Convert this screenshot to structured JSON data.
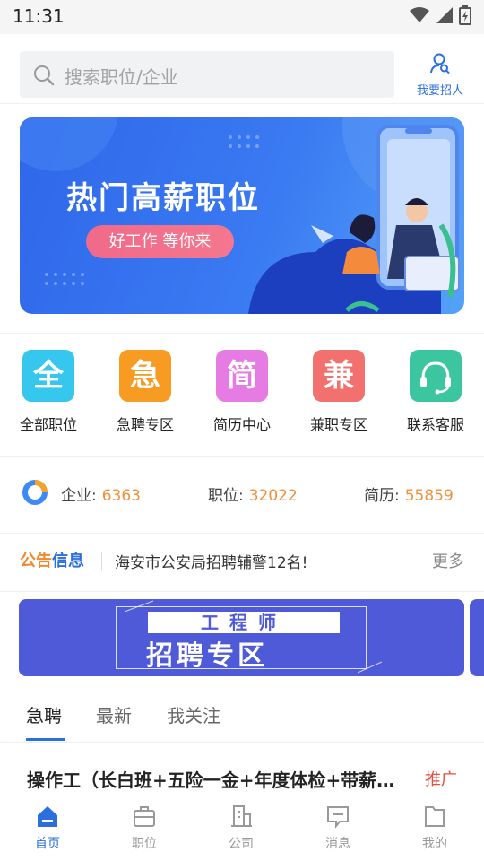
{
  "status_bar": {
    "time": "11:31",
    "icons": [
      "wifi-icon",
      "signal-icon",
      "battery-icon"
    ]
  },
  "search": {
    "placeholder": "搜索职位/企业",
    "recruit_label": "我要招人"
  },
  "banner": {
    "title": "热门高薪职位",
    "pill": "好工作 等你来"
  },
  "categories": [
    {
      "glyph": "全",
      "label": "全部职位",
      "color": "#35c7ee"
    },
    {
      "glyph": "急",
      "label": "急聘专区",
      "color": "#f79b22"
    },
    {
      "glyph": "简",
      "label": "简历中心",
      "color": "#e57be3"
    },
    {
      "glyph": "兼",
      "label": "兼职专区",
      "color": "#f2706d"
    },
    {
      "glyph": "",
      "label": "联系客服",
      "color": "#3cc6a0",
      "icon": "headset-icon"
    }
  ],
  "stats": {
    "company_label": "企业:",
    "company_value": "6363",
    "job_label": "职位:",
    "job_value": "32022",
    "resume_label": "简历:",
    "resume_value": "55859"
  },
  "notice": {
    "logo_a": "公告",
    "logo_b": "信息",
    "text": "海安市公安局招聘辅警12名!",
    "more": "更多"
  },
  "promo": {
    "line1": "工程师",
    "line2": "招聘专区"
  },
  "tabs": [
    {
      "label": "急聘",
      "active": true
    },
    {
      "label": "最新",
      "active": false
    },
    {
      "label": "我关注",
      "active": false
    }
  ],
  "job": {
    "title": "操作工（长白班+五险一金+年度体检+带薪年假）",
    "tag": "推广"
  },
  "tabbar": [
    {
      "label": "首页",
      "icon": "home-icon",
      "active": true
    },
    {
      "label": "职位",
      "icon": "briefcase-icon",
      "active": false
    },
    {
      "label": "公司",
      "icon": "building-icon",
      "active": false
    },
    {
      "label": "消息",
      "icon": "message-icon",
      "active": false
    },
    {
      "label": "我的",
      "icon": "profile-icon",
      "active": false
    }
  ],
  "colors": {
    "accent": "#2a6fdb",
    "orange": "#f0913a",
    "promo_bg": "#4f5ad9"
  }
}
